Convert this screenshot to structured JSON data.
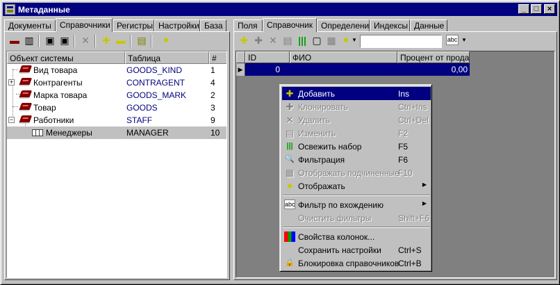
{
  "window": {
    "title": "Метаданные"
  },
  "title_buttons": {
    "minimize": "_",
    "maximize": "□",
    "close": "×"
  },
  "left_panel": {
    "tabs": [
      "Документы",
      "Справочники",
      "Регистры",
      "Настройки",
      "База"
    ],
    "active_tab": 1,
    "tree": {
      "columns": [
        "Объект системы",
        "Таблица",
        "#"
      ],
      "rows": [
        {
          "name": "Вид товара",
          "table": "GOODS_KIND",
          "num": "1"
        },
        {
          "name": "Контрагенты",
          "table": "CONTRAGENT",
          "num": "4",
          "expander": "+"
        },
        {
          "name": "Марка товара",
          "table": "GOODS_MARK",
          "num": "2"
        },
        {
          "name": "Товар",
          "table": "GOODS",
          "num": "3"
        },
        {
          "name": "Работники",
          "table": "STAFF",
          "num": "9",
          "expander": "−"
        },
        {
          "name": "Менеджеры",
          "table": "MANAGER",
          "num": "10",
          "selected": true
        }
      ]
    }
  },
  "right_panel": {
    "tabs": [
      "Поля",
      "Справочник",
      "Определение",
      "Индексы",
      "Данные"
    ],
    "active_tab": 1,
    "filter_value": "",
    "filter_icon_text": "abc",
    "grid": {
      "columns": [
        "ID",
        "ФИО",
        "Процент от продаж"
      ],
      "row": {
        "id": "0",
        "fio": "",
        "percent": "0,00"
      }
    }
  },
  "context_menu": {
    "items": [
      {
        "label": "Добавить",
        "shortcut": "Ins",
        "icon": "plus-icon",
        "glyph": "✚",
        "state": "highlighted"
      },
      {
        "label": "Клонировать",
        "shortcut": "Ctrl+Ins",
        "icon": "clone-icon",
        "glyph": "✚",
        "state": "disabled"
      },
      {
        "label": "Удалить",
        "shortcut": "Ctrl+Del",
        "icon": "delete-icon",
        "glyph": "✕",
        "state": "disabled"
      },
      {
        "label": "Изменить",
        "shortcut": "F2",
        "icon": "edit-icon",
        "glyph": "▤",
        "state": "disabled"
      },
      {
        "label": "Освежить набор",
        "shortcut": "F5",
        "icon": "refresh-icon",
        "glyph": "|||",
        "state": "enabled"
      },
      {
        "label": "Фильтрация",
        "shortcut": "F6",
        "icon": "filter-icon",
        "glyph": "🔍",
        "state": "enabled"
      },
      {
        "label": "Отображать подчиненные",
        "shortcut": "F10",
        "icon": "subordinate-icon",
        "glyph": "▦",
        "state": "disabled"
      },
      {
        "label": "Отображать",
        "shortcut": "",
        "icon": "display-icon",
        "glyph": "◆",
        "state": "enabled",
        "submenu": true
      },
      {
        "separator": true
      },
      {
        "label": "Фильтр по вхождению",
        "shortcut": "",
        "icon": "abc-filter-icon",
        "glyph": "abc",
        "state": "enabled",
        "submenu": true
      },
      {
        "label": "Очистить фильтры",
        "shortcut": "Shift+F6",
        "icon": "",
        "glyph": "",
        "state": "disabled"
      },
      {
        "separator": true
      },
      {
        "label": "Свойства колонок...",
        "shortcut": "",
        "icon": "columns-icon",
        "glyph": "▮▮▮",
        "state": "enabled"
      },
      {
        "label": "Сохранить настройки",
        "shortcut": "Ctrl+S",
        "icon": "",
        "glyph": "",
        "state": "enabled"
      },
      {
        "label": "Блокировка справочников",
        "shortcut": "Ctrl+B",
        "icon": "lock-icon",
        "glyph": "🔒",
        "state": "enabled"
      }
    ]
  },
  "colors": {
    "title_bar": "#000080",
    "highlight": "#000080",
    "table_name_text": "#000080",
    "book_icon": "#800000",
    "refresh_icon": "#00a000",
    "plus_icon": "#c8c800"
  }
}
